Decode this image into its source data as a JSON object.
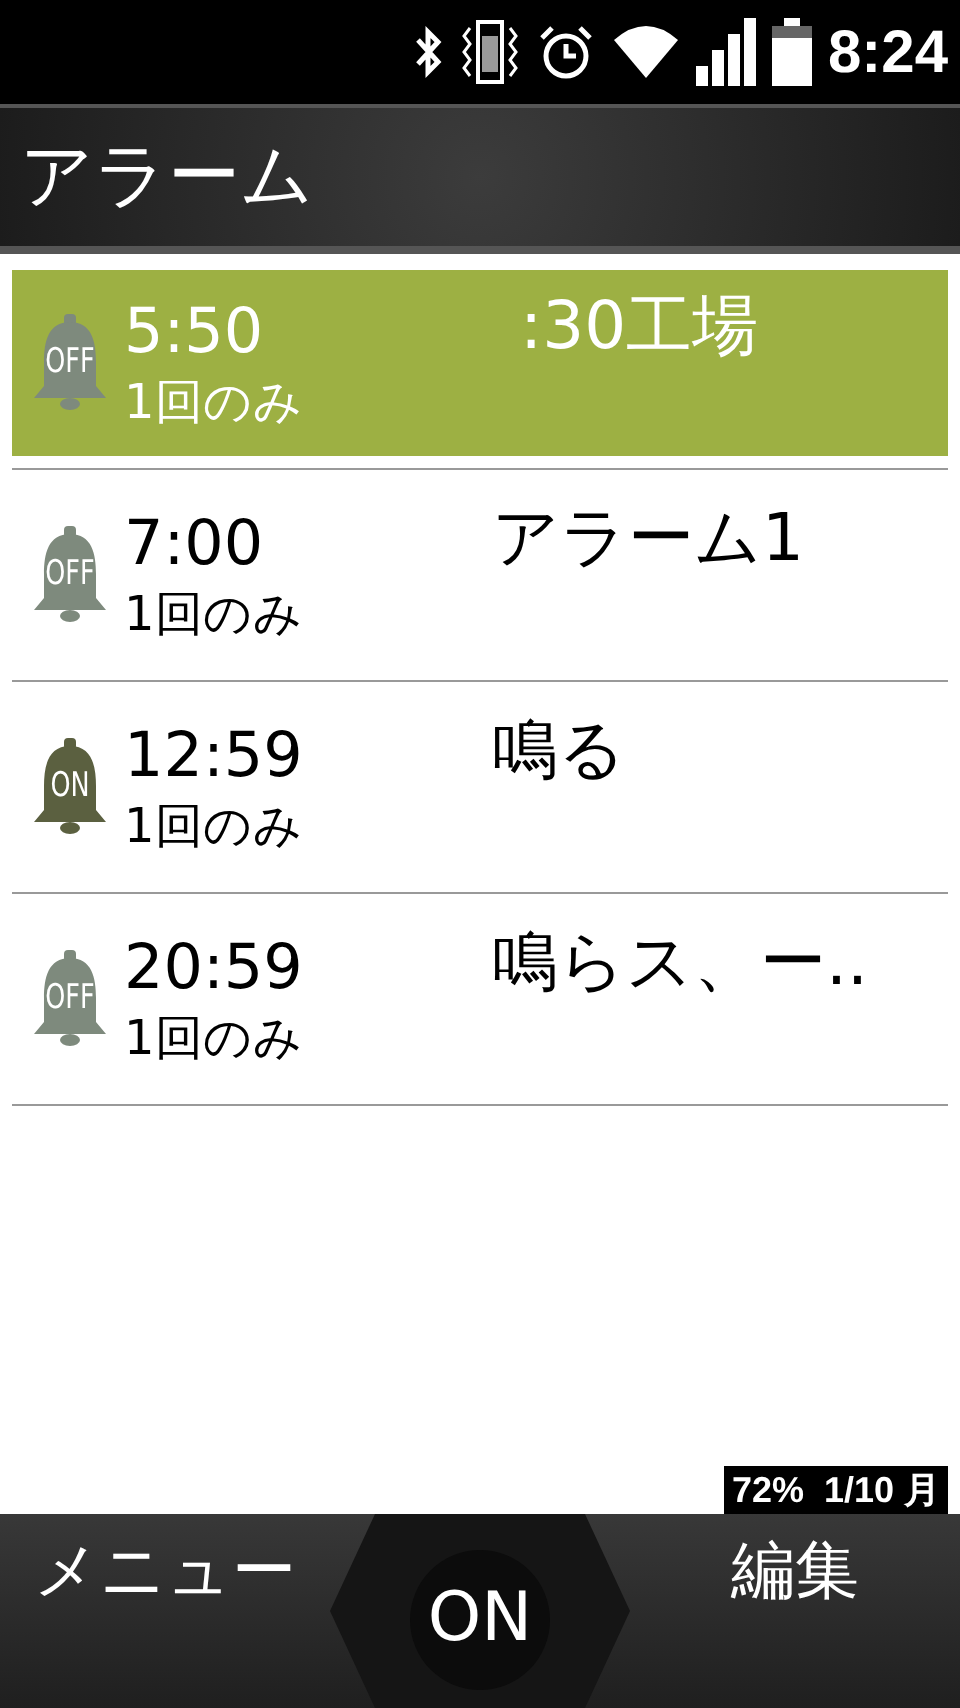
{
  "status_bar": {
    "time": "8:24"
  },
  "title": "アラーム",
  "alarms": [
    {
      "time": "5:50",
      "repeat": "1回のみ",
      "name": ":30工場",
      "on": false,
      "badge": "OFF",
      "selected": true
    },
    {
      "time": "7:00",
      "repeat": "1回のみ",
      "name": "アラーム1",
      "on": false,
      "badge": "OFF",
      "selected": false
    },
    {
      "time": "12:59",
      "repeat": "1回のみ",
      "name": "鳴る",
      "on": true,
      "badge": "ON",
      "selected": false
    },
    {
      "time": "20:59",
      "repeat": "1回のみ",
      "name": "鳴らス、ー..",
      "on": false,
      "badge": "OFF",
      "selected": false
    }
  ],
  "info": "72%  1/10 月",
  "softkeys": {
    "left": "メニュー",
    "center": "ON",
    "right": "編集"
  }
}
